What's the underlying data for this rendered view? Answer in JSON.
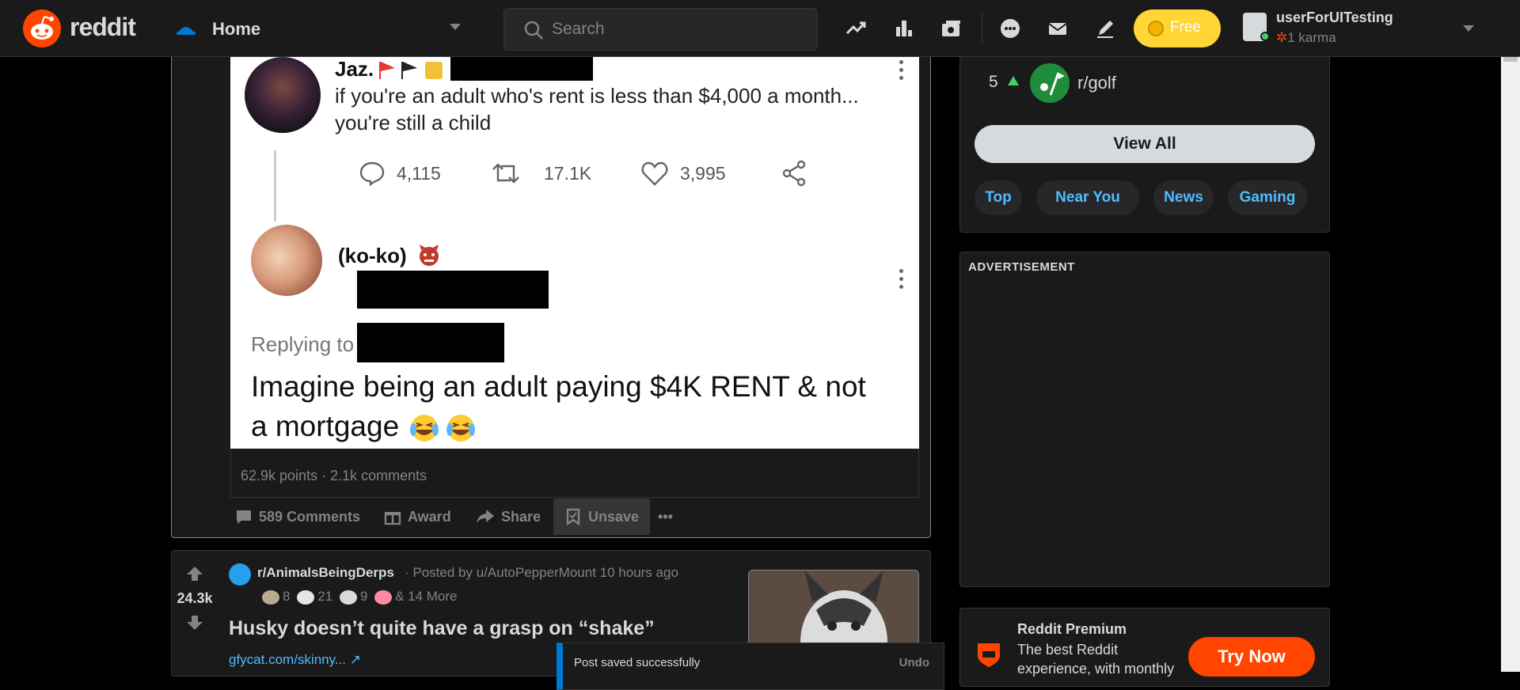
{
  "header": {
    "logo_text": "reddit",
    "home_label": "Home",
    "search_placeholder": "Search",
    "free_label": "Free",
    "username": "userForUITesting",
    "karma": "1 karma",
    "icons": [
      "popular-icon",
      "all-icon",
      "rpan-icon",
      "chat-icon",
      "inbox-icon",
      "create-post-icon"
    ]
  },
  "post1": {
    "tweet1": {
      "name": "Jaz.",
      "text_line1": "if you're an adult who's rent is less than $4,000 a month...",
      "text_line2": "you're still a child",
      "replies": "4,115",
      "retweets": "17.1K",
      "likes": "3,995"
    },
    "tweet2": {
      "name": "(ko-ko)",
      "replying_to": "Replying to",
      "text_line1": "Imagine being an adult paying $4K RENT & not",
      "text_line2": "a mortgage"
    },
    "stats": "62.9k points · 2.1k comments",
    "actions": {
      "comments": "589 Comments",
      "award": "Award",
      "share": "Share",
      "unsave": "Unsave",
      "more": "•••"
    }
  },
  "post2": {
    "votes": "24.3k",
    "subreddit": "r/AnimalsBeingDerps",
    "meta": "· Posted by u/AutoPepperMount 10 hours ago",
    "awards": {
      "a1": "8",
      "a2": "21",
      "a3": "9",
      "more": "& 14 More"
    },
    "title": "Husky doesn’t quite have a grasp on “shake”",
    "link": "gfycat.com/skinny..."
  },
  "sidebar": {
    "rank": "5",
    "community": "r/golf",
    "view_all": "View All",
    "chips": [
      "Top",
      "Near You",
      "News",
      "Gaming"
    ],
    "ad_label": "ADVERTISEMENT",
    "premium_title": "Reddit Premium",
    "premium_desc": "The best Reddit experience, with monthly",
    "try_now": "Try Now"
  },
  "toast": {
    "message": "Post saved successfully",
    "undo": "Undo"
  },
  "colors": {
    "accent": "#ff4500",
    "link": "#4fbcff",
    "bg": "#1a1a1b"
  }
}
